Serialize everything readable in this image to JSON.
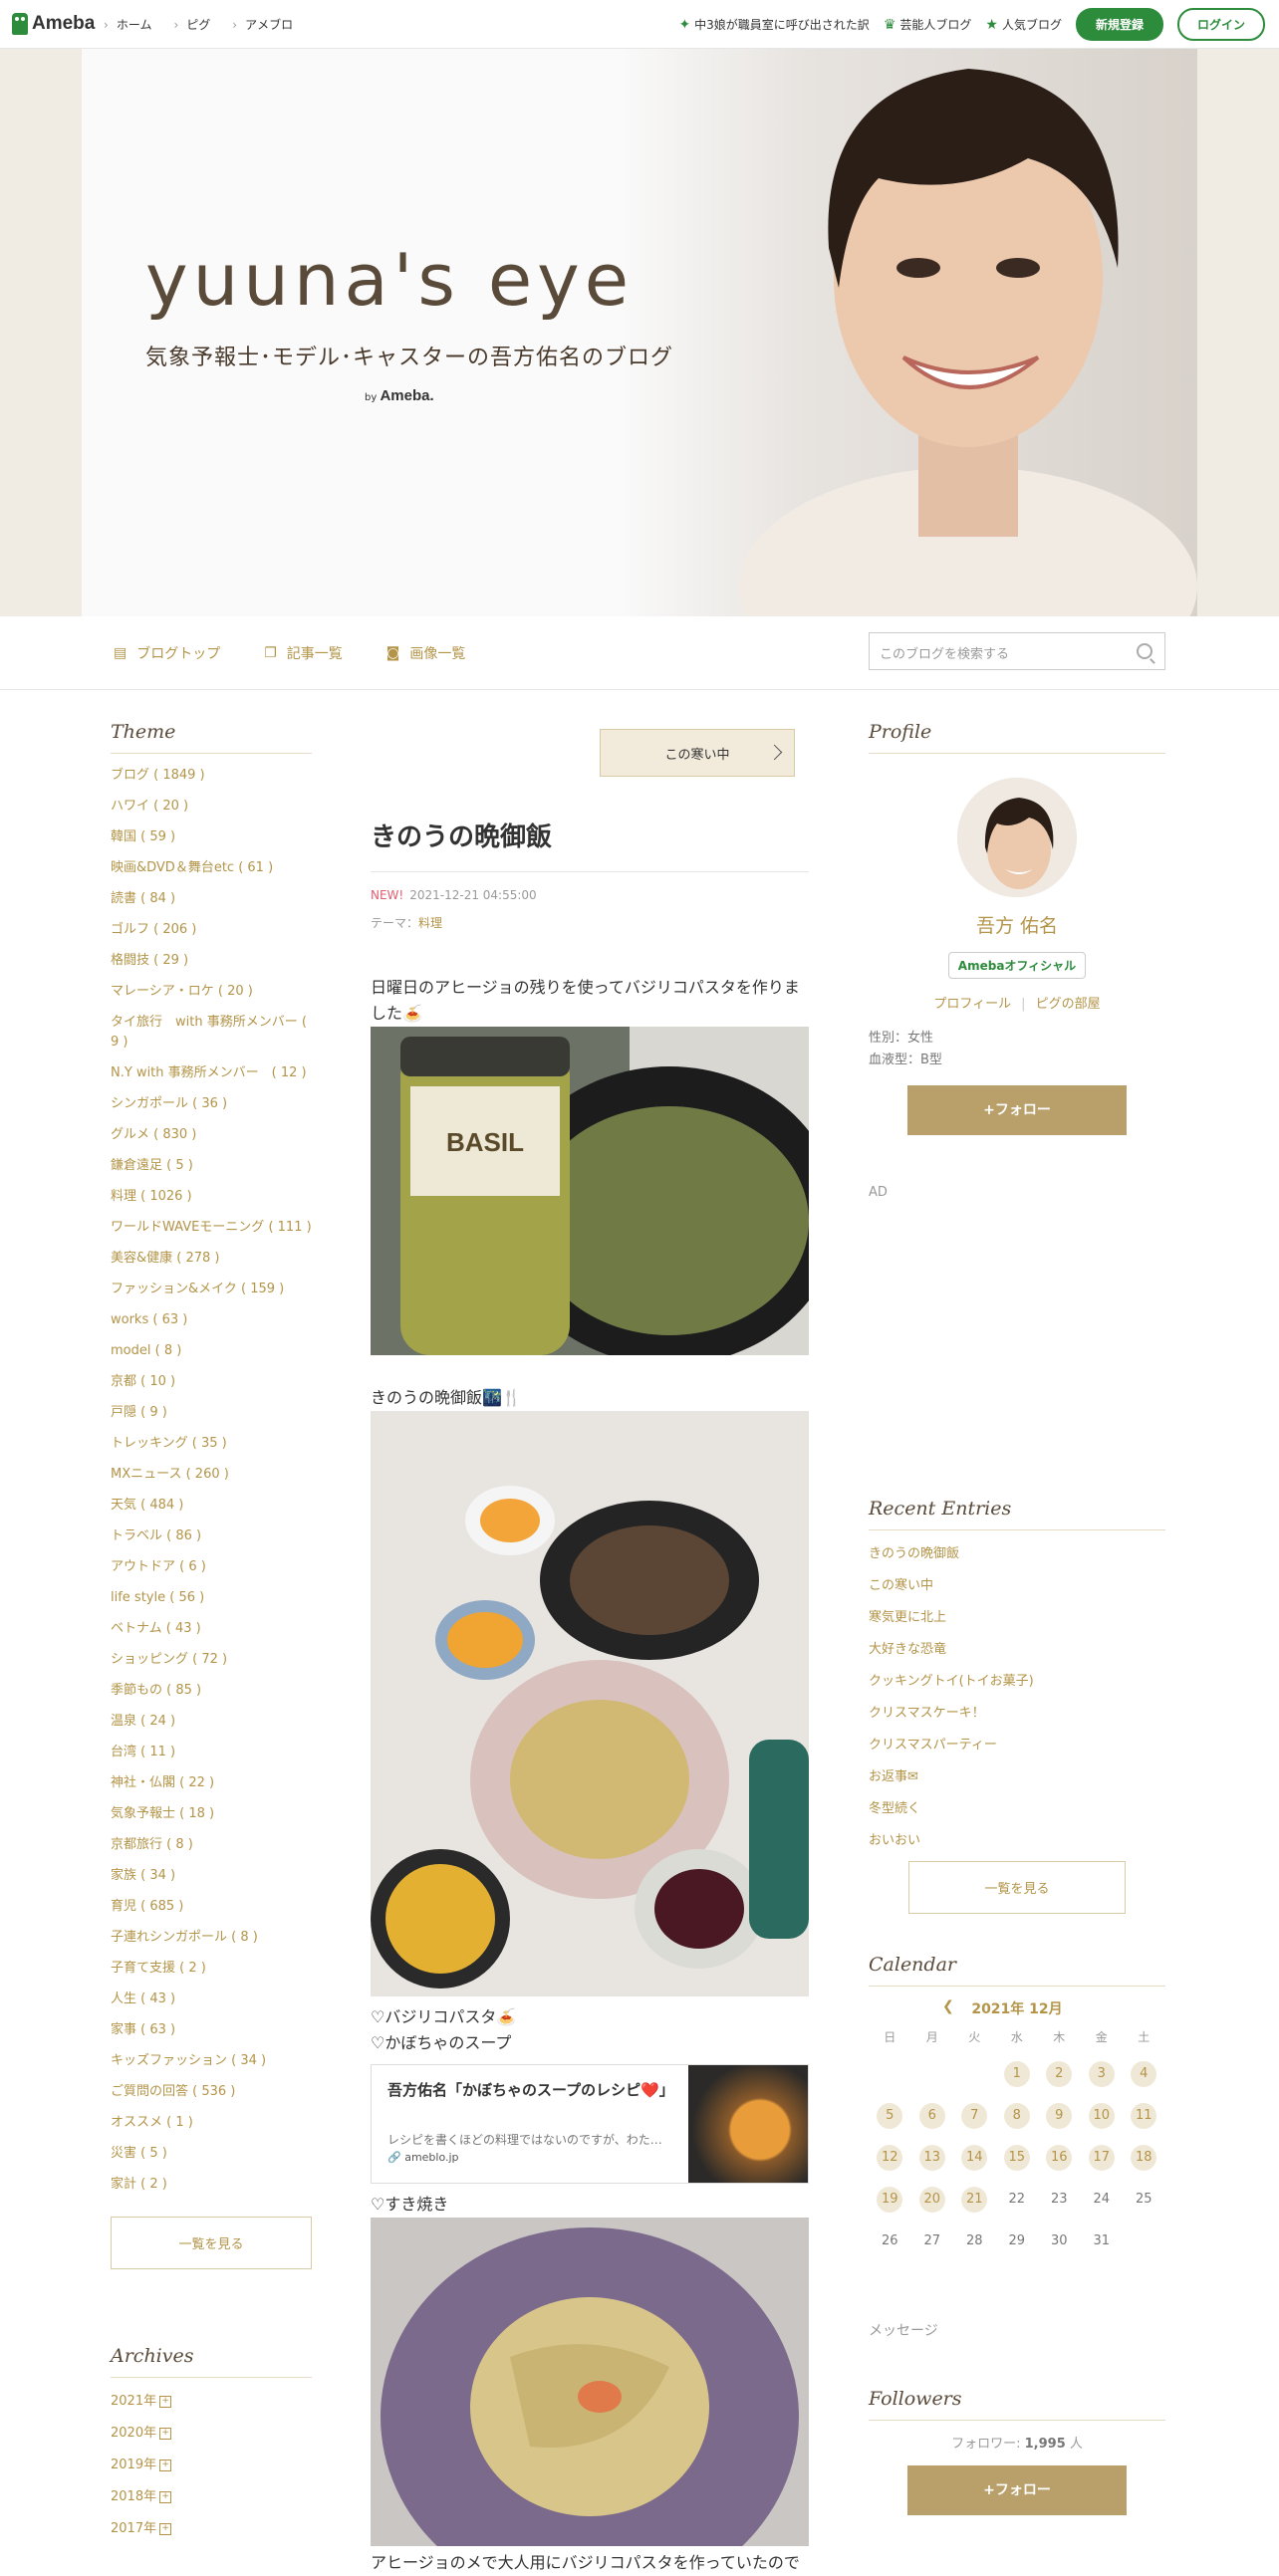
{
  "topbar": {
    "logo": "Ameba",
    "nav": [
      "ホーム",
      "ピグ",
      "アメブロ"
    ],
    "links": [
      {
        "icon": "leaf-icon",
        "label": "中3娘が職員室に呼び出された訳"
      },
      {
        "icon": "crown-icon",
        "label": "芸能人ブログ"
      },
      {
        "icon": "star-icon",
        "label": "人気ブログ"
      }
    ],
    "register_label": "新規登録",
    "login_label": "ログイン",
    "brand_green": "#2d8c3c"
  },
  "header": {
    "title": "yuuna's eye",
    "subtitle": "気象予報士･モデル･キャスターの吾方佑名のブログ",
    "by_prefix": "by",
    "by_brand": "Ameba."
  },
  "subnav": {
    "items": [
      {
        "icon": "document-icon",
        "label": "ブログトップ"
      },
      {
        "icon": "copy-icon",
        "label": "記事一覧"
      },
      {
        "icon": "camera-icon",
        "label": "画像一覧"
      }
    ],
    "search_placeholder": "このブログを検索する"
  },
  "theme": {
    "heading": "Theme",
    "items": [
      "ブログ ( 1849 )",
      "ハワイ ( 20 )",
      "韓国 ( 59 )",
      "映画&DVD＆舞台etc ( 61 )",
      "読書 ( 84 )",
      "ゴルフ ( 206 )",
      "格闘技 ( 29 )",
      "マレーシア・ロケ ( 20 )",
      "タイ旅行　with 事務所メンバー ( 9 )",
      "N.Y with 事務所メンバー　( 12 )",
      "シンガポール ( 36 )",
      "グルメ ( 830 )",
      "鎌倉遠足 ( 5 )",
      "料理 ( 1026 )",
      "ワールドWAVEモーニング ( 111 )",
      "美容&健康 ( 278 )",
      "ファッション&メイク ( 159 )",
      "works ( 63 )",
      "model ( 8 )",
      "京都 ( 10 )",
      "戸隠 ( 9 )",
      "トレッキング ( 35 )",
      "MXニュース ( 260 )",
      "天気 ( 484 )",
      "トラベル ( 86 )",
      "アウトドア ( 6 )",
      "life style ( 56 )",
      "ベトナム ( 43 )",
      "ショッピング ( 72 )",
      "季節もの ( 85 )",
      "温泉 ( 24 )",
      "台湾 ( 11 )",
      "神社・仏閣 ( 22 )",
      "気象予報士 ( 18 )",
      "京都旅行 ( 8 )",
      "家族 ( 34 )",
      "育児 ( 685 )",
      "子連れシンガポール ( 8 )",
      "子育て支援 ( 2 )",
      "人生 ( 43 )",
      "家事 ( 63 )",
      "キッズファッション ( 34 )",
      "ご質問の回答 ( 536 )",
      "オススメ ( 1 )",
      "災害 ( 5 )",
      "家計 ( 2 )"
    ],
    "see_all": "一覧を見る"
  },
  "archives": {
    "heading": "Archives",
    "items": [
      "2021年",
      "2020年",
      "2019年",
      "2018年",
      "2017年"
    ]
  },
  "entry": {
    "next_post": "この寒い中",
    "title": "きのうの晩御飯",
    "new_label": "NEW!",
    "datetime": "2021-12-21 04:55:00",
    "theme_prefix": "テーマ：",
    "theme": "料理",
    "p1": "日曜日のアヒージョの残りを使ってバジリコパスタを作りました🍝",
    "p2": "きのうの晩御飯🌃🍴",
    "p3": "♡バジリコパスタ🍝",
    "p4": "♡かぼちゃのスープ",
    "card": {
      "title": "吾方佑名「かぼちゃのスープのレシピ❤️」",
      "desc": "レシピを書くほどの料理ではないのですが、わた…",
      "url": "ameblo.jp"
    },
    "p5": "♡すき焼き",
    "p6": "アヒージョのメで大人用にバジリコパスタを作っていたので"
  },
  "profile": {
    "heading": "Profile",
    "name": "吾方 佑名",
    "badge": "Amebaオフィシャル",
    "link1": "プロフィール",
    "link2": "ピグの部屋",
    "gender": "性別：女性",
    "blood": "血液型：B型",
    "follow": "+フォロー",
    "ad": "AD"
  },
  "recent": {
    "heading": "Recent Entries",
    "items": [
      "きのうの晩御飯",
      "この寒い中",
      "寒気更に北上",
      "大好きな恐竜",
      "クッキングトイ(トイお菓子)",
      "クリスマスケーキ！",
      "クリスマスパーティー",
      "お返事✉",
      "冬型続く",
      "おいおい"
    ],
    "see_all": "一覧を見る"
  },
  "calendar": {
    "heading": "Calendar",
    "month": "2021年 12月",
    "dow": [
      "日",
      "月",
      "火",
      "水",
      "木",
      "金",
      "土"
    ],
    "days": [
      "",
      "",
      "",
      "1",
      "2",
      "3",
      "4",
      "5",
      "6",
      "7",
      "8",
      "9",
      "10",
      "11",
      "12",
      "13",
      "14",
      "15",
      "16",
      "17",
      "18",
      "19",
      "20",
      "21",
      "22",
      "23",
      "24",
      "25",
      "26",
      "27",
      "28",
      "29",
      "30",
      "31"
    ],
    "active_days": [
      "1",
      "2",
      "3",
      "4",
      "5",
      "6",
      "7",
      "8",
      "9",
      "10",
      "11",
      "12",
      "13",
      "14",
      "15",
      "16",
      "17",
      "18",
      "19",
      "20",
      "21"
    ]
  },
  "message": "メッセージ",
  "followers": {
    "heading": "Followers",
    "label": "フォロワー:",
    "count": "1,995",
    "unit": "人",
    "follow": "+フォロー"
  }
}
